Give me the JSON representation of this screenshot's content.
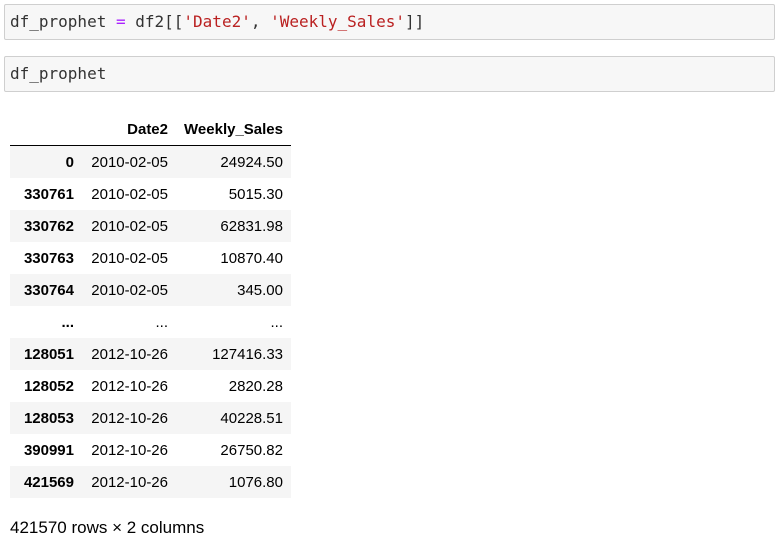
{
  "cells": [
    {
      "tokens": [
        {
          "text": "df_prophet",
          "kind": "var"
        },
        {
          "text": " ",
          "kind": "punct"
        },
        {
          "text": "=",
          "kind": "op"
        },
        {
          "text": " df2[[",
          "kind": "var"
        },
        {
          "text": "'Date2'",
          "kind": "str"
        },
        {
          "text": ", ",
          "kind": "punct"
        },
        {
          "text": "'Weekly_Sales'",
          "kind": "str"
        },
        {
          "text": "]]",
          "kind": "punct"
        }
      ]
    },
    {
      "tokens": [
        {
          "text": "df_prophet",
          "kind": "var"
        }
      ]
    }
  ],
  "table": {
    "columns": [
      "",
      "Date2",
      "Weekly_Sales"
    ],
    "rows": [
      {
        "index": "0",
        "date": "2010-02-05",
        "sales": "24924.50"
      },
      {
        "index": "330761",
        "date": "2010-02-05",
        "sales": "5015.30"
      },
      {
        "index": "330762",
        "date": "2010-02-05",
        "sales": "62831.98"
      },
      {
        "index": "330763",
        "date": "2010-02-05",
        "sales": "10870.40"
      },
      {
        "index": "330764",
        "date": "2010-02-05",
        "sales": "345.00"
      },
      {
        "index": "...",
        "date": "...",
        "sales": "..."
      },
      {
        "index": "128051",
        "date": "2012-10-26",
        "sales": "127416.33"
      },
      {
        "index": "128052",
        "date": "2012-10-26",
        "sales": "2820.28"
      },
      {
        "index": "128053",
        "date": "2012-10-26",
        "sales": "40228.51"
      },
      {
        "index": "390991",
        "date": "2012-10-26",
        "sales": "26750.82"
      },
      {
        "index": "421569",
        "date": "2012-10-26",
        "sales": "1076.80"
      }
    ],
    "shape_text": "421570 rows × 2 columns"
  },
  "colors": {
    "string": "#ba2121",
    "operator": "#aa22ff",
    "cell_background": "#f7f7f7",
    "cell_border": "#cfcfcf",
    "row_stripe": "#f5f5f5"
  }
}
